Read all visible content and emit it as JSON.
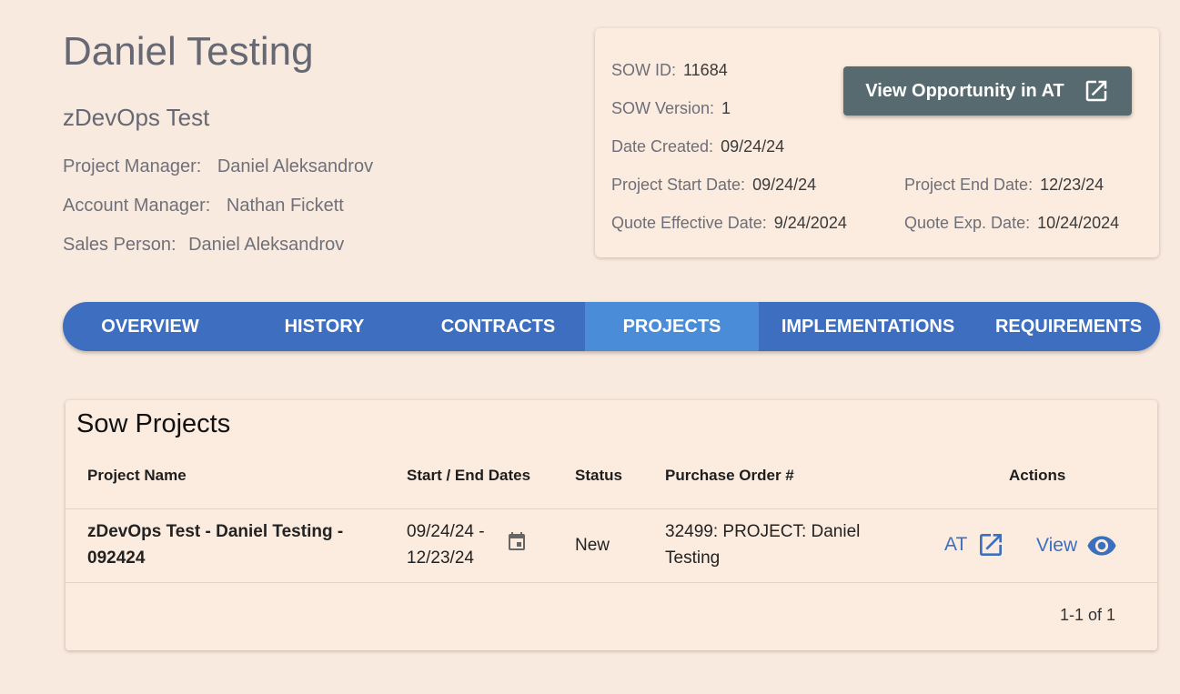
{
  "header": {
    "title": "Daniel Testing",
    "subtitle": "zDevOps Test",
    "project_manager_label": "Project Manager:",
    "project_manager": "Daniel Aleksandrov",
    "account_manager_label": "Account Manager:",
    "account_manager": "Nathan Fickett",
    "sales_person_label": "Sales Person:",
    "sales_person": "Daniel Aleksandrov"
  },
  "sow": {
    "id_label": "SOW ID:",
    "id": "11684",
    "version_label": "SOW Version:",
    "version": "1",
    "created_label": "Date Created:",
    "created": "09/24/24",
    "start_label": "Project Start Date:",
    "start": "09/24/24",
    "end_label": "Project End Date:",
    "end": "12/23/24",
    "quote_eff_label": "Quote Effective Date:",
    "quote_eff": "9/24/2024",
    "quote_exp_label": "Quote Exp. Date:",
    "quote_exp": "10/24/2024",
    "view_opportunity_label": "View Opportunity in AT"
  },
  "tabs": [
    {
      "label": "OVERVIEW"
    },
    {
      "label": "HISTORY"
    },
    {
      "label": "CONTRACTS"
    },
    {
      "label": "PROJECTS"
    },
    {
      "label": "IMPLEMENTATIONS"
    },
    {
      "label": "REQUIREMENTS"
    }
  ],
  "active_tab": "PROJECTS",
  "projects_table": {
    "title": "Sow Projects",
    "columns": [
      "Project Name",
      "Start / End Dates",
      "Status",
      "Purchase Order #",
      "Actions"
    ],
    "rows": [
      {
        "name_line1": "zDevOps Test - Daniel Testing -",
        "name_line2": "092424",
        "start": "09/24/24 -",
        "end": "12/23/24",
        "status": "New",
        "po_line1": "32499: PROJECT: Daniel",
        "po_line2": "Testing",
        "at_label": "AT",
        "view_label": "View"
      }
    ],
    "pagination": "1-1 of 1"
  },
  "colors": {
    "background": "#f9eadf",
    "tab_bar": "#3d6ec0",
    "tab_active": "#4b8cd9",
    "button": "#566a6f",
    "link": "#3c6fbe"
  },
  "icons": [
    "open-in-new-icon",
    "calendar-icon",
    "eye-icon"
  ]
}
